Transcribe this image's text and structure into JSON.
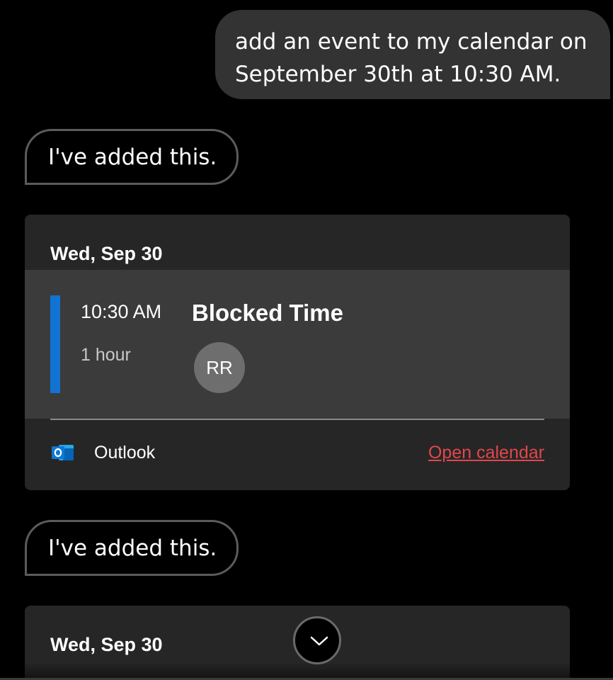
{
  "conversation": {
    "user_message": "add an event to my calendar on September 30th at 10:30 AM.",
    "replies": [
      {
        "text": "I've added this."
      },
      {
        "text": "I've added this."
      }
    ]
  },
  "cards": [
    {
      "date": "Wed, Sep 30",
      "event": {
        "time": "10:30 AM",
        "duration": "1 hour",
        "title": "Blocked Time",
        "attendee_initials": "RR",
        "accent_color": "#1173d4"
      },
      "footer": {
        "source_icon": "outlook-icon",
        "source": "Outlook",
        "action": "Open calendar",
        "action_color": "#e0474c"
      }
    },
    {
      "date": "Wed, Sep 30"
    }
  ],
  "scroll_button": {
    "icon": "chevron-down-icon"
  }
}
